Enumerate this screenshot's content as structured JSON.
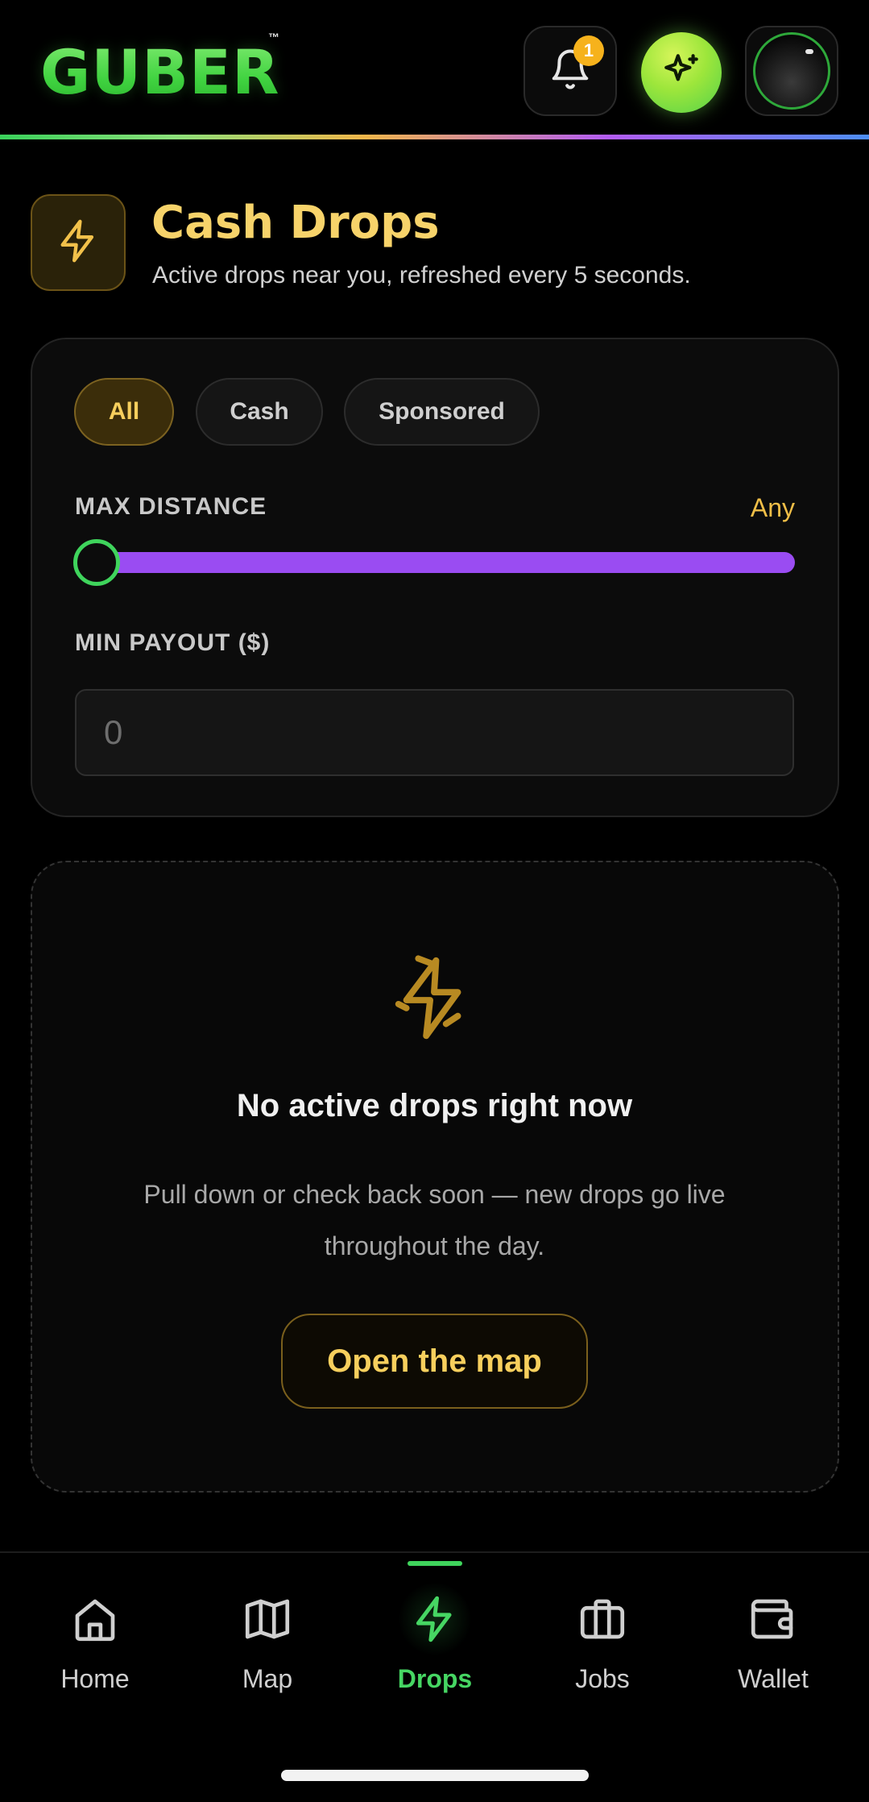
{
  "header": {
    "logo_text": "GUBER",
    "trademark": "™",
    "notification_count": "1",
    "accent_colors": {
      "brand_green": "#3fd13f",
      "gold": "#f7d36a",
      "purple": "#9a4cf2"
    }
  },
  "page": {
    "title": "Cash Drops",
    "subtitle": "Active drops near you, refreshed every 5 seconds."
  },
  "filters": {
    "chips": [
      {
        "label": "All",
        "active": true
      },
      {
        "label": "Cash",
        "active": false
      },
      {
        "label": "Sponsored",
        "active": false
      }
    ],
    "max_distance_label": "MAX DISTANCE",
    "max_distance_value": "Any",
    "max_distance_slider_fraction": 0.0,
    "min_payout_label": "MIN PAYOUT ($)",
    "min_payout_placeholder": "0",
    "min_payout_value": ""
  },
  "empty_state": {
    "icon": "zap-off-icon",
    "title": "No active drops right now",
    "text": "Pull down or check back soon — new drops go live throughout the day.",
    "button_label": "Open the map"
  },
  "nav": {
    "items": [
      {
        "label": "Home",
        "icon": "home-icon",
        "active": false
      },
      {
        "label": "Map",
        "icon": "map-icon",
        "active": false
      },
      {
        "label": "Drops",
        "icon": "zap-icon",
        "active": true
      },
      {
        "label": "Jobs",
        "icon": "briefcase-icon",
        "active": false
      },
      {
        "label": "Wallet",
        "icon": "wallet-icon",
        "active": false
      }
    ]
  }
}
